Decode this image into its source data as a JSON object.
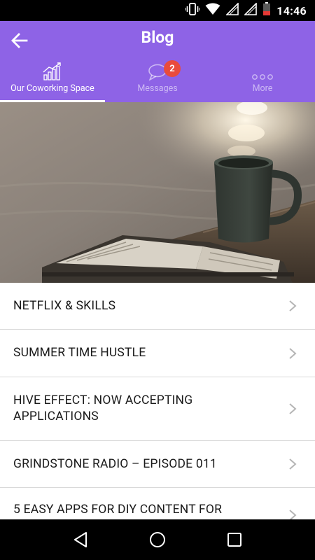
{
  "status_bar": {
    "time": "14:46",
    "icons": [
      "vibrate-icon",
      "wifi-icon",
      "signal-icon",
      "signal-icon",
      "battery-icon"
    ]
  },
  "app_bar": {
    "title": "Blog",
    "back_icon": "arrow-left-icon",
    "background": "#8e63e6"
  },
  "tabs": [
    {
      "label": "Our Coworking Space",
      "icon": "bar-chart-icon",
      "active": true
    },
    {
      "label": "Messages",
      "icon": "chat-bubble-icon",
      "badge": "2",
      "active": false
    },
    {
      "label": "More",
      "icon": "more-dots-icon",
      "active": false
    }
  ],
  "hero": {
    "image": "coffee-mug-and-open-book-photo"
  },
  "list": {
    "items": [
      {
        "title": "NETFLIX & SKILLS"
      },
      {
        "title": "SUMMER TIME HUSTLE"
      },
      {
        "title": "HIVE EFFECT: NOW ACCEPTING APPLICATIONS"
      },
      {
        "title": "GRINDSTONE RADIO – EPISODE 011"
      },
      {
        "title": "5 EASY APPS FOR DIY CONTENT FOR"
      }
    ]
  },
  "nav_bar": {
    "buttons": [
      "back-triangle-icon",
      "home-circle-icon",
      "recents-square-icon"
    ]
  },
  "colors": {
    "accent": "#8e63e6",
    "badge": "#e94b3c"
  }
}
